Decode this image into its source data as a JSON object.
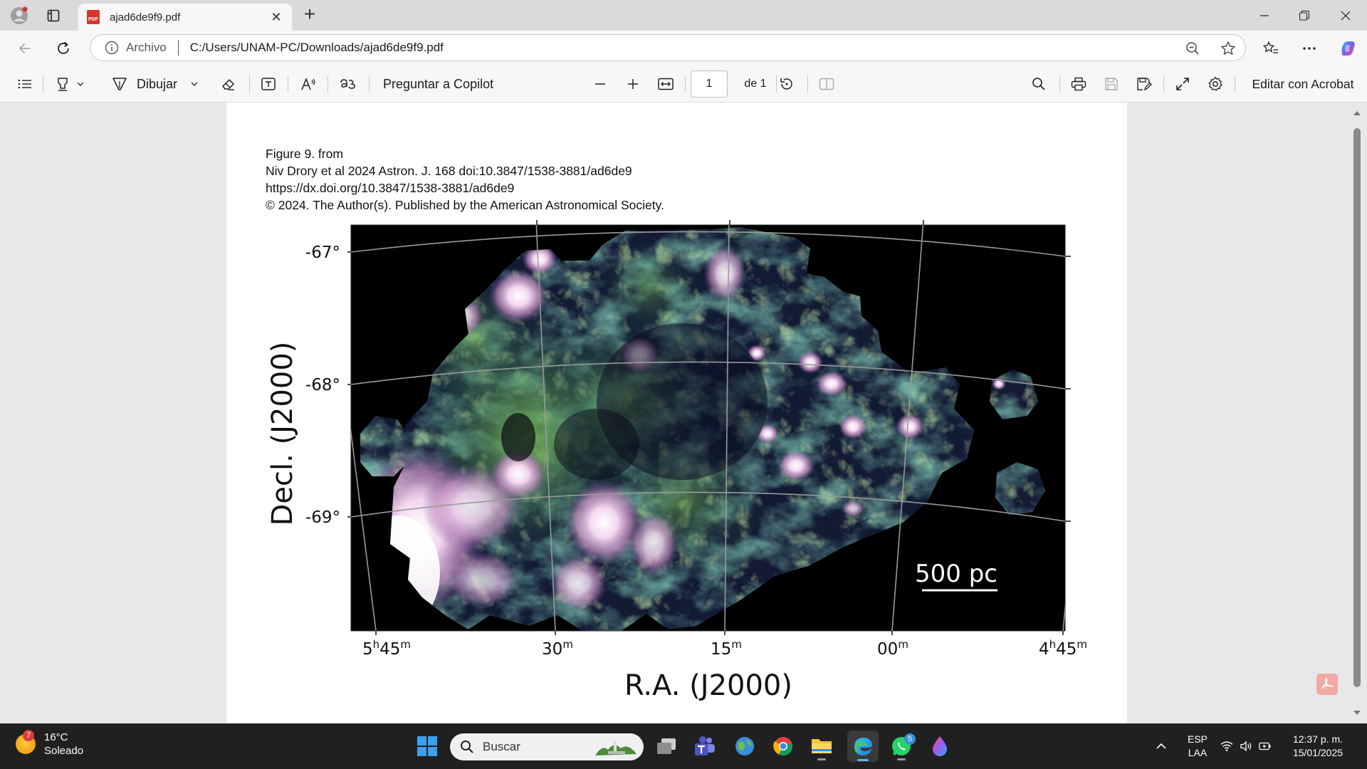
{
  "tab": {
    "title": "ajad6de9f9.pdf",
    "pdf_badge": "PDF"
  },
  "address": {
    "scheme_label": "Archivo",
    "url": "C:/Users/UNAM-PC/Downloads/ajad6de9f9.pdf"
  },
  "pdf_toolbar": {
    "draw_label": "Dibujar",
    "copilot_label": "Preguntar a Copilot",
    "page_current": "1",
    "page_total": "de 1",
    "edit_acrobat_label": "Editar con Acrobat"
  },
  "document": {
    "caption_lines": [
      "Figure 9. from",
      "Niv Drory et al 2024 Astron. J. 168 doi:10.3847/1538-3881/ad6de9",
      "https://dx.doi.org/10.3847/1538-3881/ad6de9",
      "© 2024. The Author(s). Published by the American Astronomical Society."
    ],
    "figure": {
      "ylabel": "Decl. (J2000)",
      "xlabel": "R.A. (J2000)",
      "dec_ticks": [
        "-67°",
        "-68°",
        "-69°"
      ],
      "ra_ticks": [
        {
          "h": "5",
          "hs": "h",
          "m": "45",
          "ms": "m"
        },
        {
          "h": "",
          "hs": "",
          "m": "30",
          "ms": "m"
        },
        {
          "h": "",
          "hs": "",
          "m": "15",
          "ms": "m"
        },
        {
          "h": "",
          "hs": "",
          "m": "00",
          "ms": "m"
        },
        {
          "h": "4",
          "hs": "h",
          "m": "45",
          "ms": "m"
        }
      ],
      "scale_bar_label": "500 pc"
    }
  },
  "taskbar": {
    "weather_temp": "16°C",
    "weather_desc": "Soleado",
    "weather_badge": "7",
    "search_placeholder": "Buscar",
    "whatsapp_badge": "5",
    "lang_top": "ESP",
    "lang_bottom": "LAA",
    "time": "12:37 p. m.",
    "date": "15/01/2025"
  },
  "colors": {
    "accent": "#0f6cbd",
    "pdf_red": "#d9342b",
    "taskbar_bg": "#202020"
  }
}
